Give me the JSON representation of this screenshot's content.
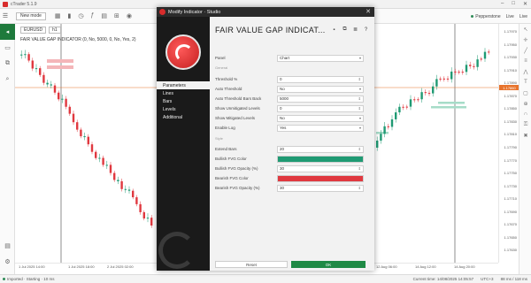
{
  "window": {
    "title": "cTrader 5.1.9"
  },
  "toolbar": {
    "new_mode_label": "New mode",
    "right_items": [
      "Pepperstone",
      "Live",
      "Live"
    ]
  },
  "chart": {
    "symbol": "EURUSD",
    "timeframe": "h1",
    "indicator_label": "FAIR VALUE GAP INDICATOR (0, No, 5000, 0, No, Yes, 2)",
    "price_ticks": [
      "1.17970",
      "1.17950",
      "1.17930",
      "1.17910",
      "1.17890",
      "1.17870",
      "1.17850",
      "1.17830",
      "1.17810",
      "1.17790",
      "1.17770",
      "1.17750",
      "1.17730",
      "1.17710",
      "1.17690",
      "1.17670",
      "1.17650",
      "1.17630"
    ],
    "current_price": "1.17860",
    "time_ticks": [
      "1 Jul 2025 14:00",
      "1 Jul 2025 18:00",
      "2 Jul 2025 02:00",
      "12 Aug 06:00",
      "14 Aug 12:00",
      "14 Aug 20:00"
    ],
    "crosshair_label": "07:30"
  },
  "status": {
    "left": "Imported · Starting · 10 ms",
    "center": "Current time: 14/08/2025 14:05:57",
    "tz": "UTC+3",
    "right": "88 ms / 118 ms"
  },
  "dialog": {
    "titlebar": "Modify Indicator · Studio",
    "header_title": "FAIR VALUE GAP INDICAT...",
    "side_tabs": [
      "Parameters",
      "Lines",
      "Bars",
      "Levels",
      "Additional"
    ],
    "rows": {
      "panel": {
        "label": "Panel",
        "value": "Chart"
      },
      "threshold": {
        "label": "Threshold %",
        "value": "0"
      },
      "auto_threshold": {
        "label": "Auto Threshold",
        "value": "No"
      },
      "auto_threshold_bars": {
        "label": "Auto Threshold Bars Back",
        "value": "5000"
      },
      "show_unmitigated": {
        "label": "Show Unmitigated Levels",
        "value": "0"
      },
      "show_mitigated": {
        "label": "Show Mitigated Levels",
        "value": "No"
      },
      "enable_log": {
        "label": "Enable Log",
        "value": "Yes"
      },
      "extend_bars": {
        "label": "Extend Bars",
        "value": "20"
      },
      "bullish_fvg_color": {
        "label": "Bullish FVG Color"
      },
      "bullish_fvg_opacity": {
        "label": "Bullish FVG Opacity (%)",
        "value": "30"
      },
      "bearish_fvg_color": {
        "label": "Bearish FVG Color"
      },
      "bearish_fvg_opacity": {
        "label": "Bearish FVG Opacity (%)",
        "value": "30"
      }
    },
    "section_style": "Style",
    "section_general": "General",
    "reset_label": "Reset",
    "ok_label": "OK"
  },
  "colors": {
    "bullish": "#1f9a73",
    "bearish": "#e0383f",
    "ok_button": "#1f8a45",
    "price_tag": "#e8732c"
  },
  "icons": {
    "header": [
      "save-icon",
      "copy-icon",
      "list-icon",
      "help-icon"
    ],
    "left_toolbar": [
      "trade-icon",
      "chart-icon",
      "copy-icon",
      "analyze-icon",
      "watchlist-icon",
      "settings-icon"
    ],
    "right_toolbar": [
      "cursor-icon",
      "crosshair-icon",
      "line-icon",
      "fib-icon",
      "pattern-icon",
      "text-icon",
      "shape-icon",
      "zoom-icon",
      "magnet-icon",
      "lock-icon",
      "trash-icon"
    ]
  }
}
